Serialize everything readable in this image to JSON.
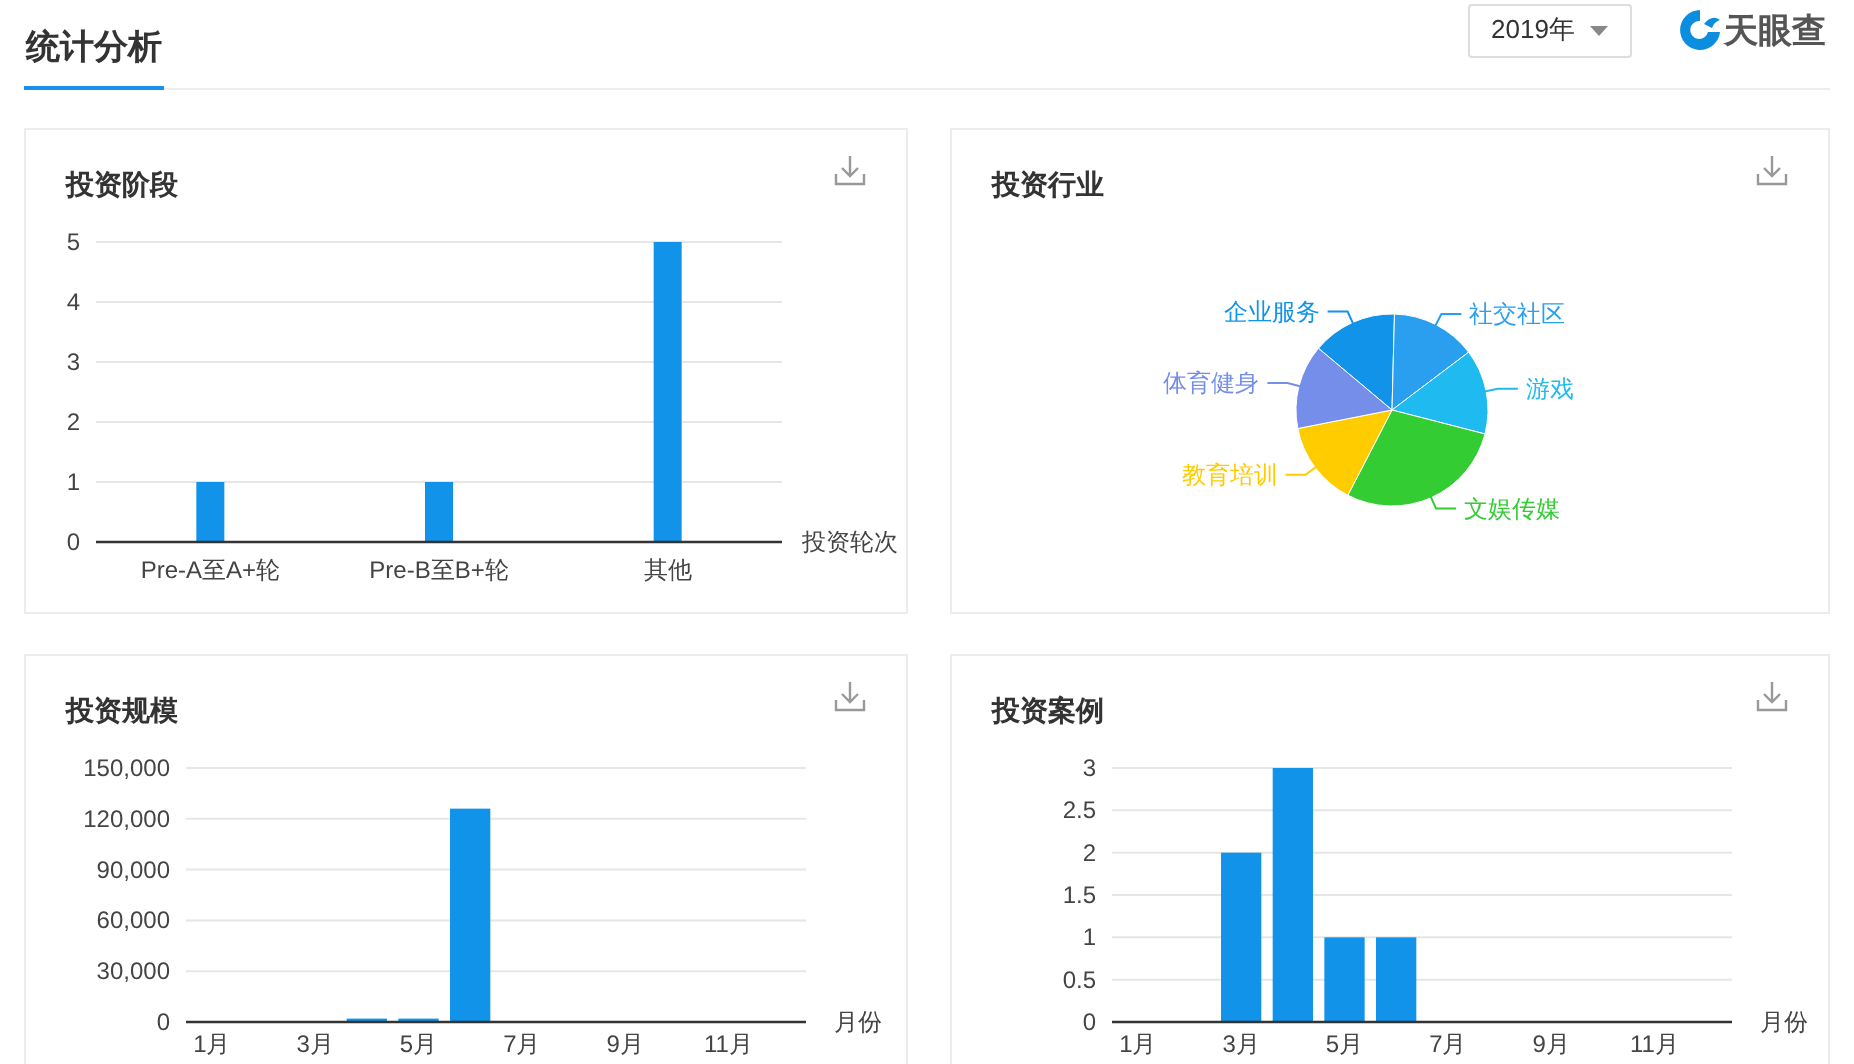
{
  "header": {
    "title": "统计分析",
    "year": "2019年",
    "logo": "天眼查"
  },
  "panels": [
    {
      "title": "投资阶段",
      "chart_data": {
        "type": "bar",
        "xlabel": "投资轮次",
        "grid": true,
        "categories": [
          "Pre-A至A+轮",
          "Pre-B至B+轮",
          "其他"
        ],
        "series": [
          {
            "color": "#1193ea",
            "values": [
              1,
              1,
              5
            ]
          }
        ],
        "ylim": [
          0,
          5
        ],
        "yticks": [
          0,
          1,
          2,
          3,
          4,
          5
        ]
      }
    },
    {
      "title": "投资行业",
      "chart_data": {
        "type": "pie",
        "categories": [
          "企业服务",
          "社交社区",
          "游戏",
          "文娱传媒",
          "教育培训",
          "体育健身"
        ],
        "colors": [
          "#1193ea",
          "#2a9ff0",
          "#1fbbf0",
          "#33cc33",
          "#ffcc00",
          "#748eea"
        ],
        "values": [
          14.3,
          14.3,
          14.3,
          28.6,
          14.3,
          14.2
        ]
      }
    },
    {
      "title": "投资规模",
      "chart_data": {
        "type": "bar",
        "xlabel": "月份",
        "grid": true,
        "x": [
          1,
          2,
          3,
          4,
          5,
          6,
          7,
          8,
          9,
          10,
          11,
          12
        ],
        "xlim": [
          0.5,
          12.5
        ],
        "xticks": [
          {
            "value": 1,
            "label": "1月"
          },
          {
            "value": 3,
            "label": "3月"
          },
          {
            "value": 5,
            "label": "5月"
          },
          {
            "value": 7,
            "label": "7月"
          },
          {
            "value": 9,
            "label": "9月"
          },
          {
            "value": 11,
            "label": "11月"
          }
        ],
        "series": [
          {
            "color": "#1193ea",
            "values": [
              0,
              0,
              0,
              2000,
              2000,
              126000,
              0,
              0,
              0,
              0,
              0,
              0
            ]
          }
        ],
        "ylim": [
          0,
          150000
        ],
        "yticks": [
          {
            "value": 0,
            "label": "0"
          },
          {
            "value": 30000,
            "label": "30,000"
          },
          {
            "value": 60000,
            "label": "60,000"
          },
          {
            "value": 90000,
            "label": "90,000"
          },
          {
            "value": 120000,
            "label": "120,000"
          },
          {
            "value": 150000,
            "label": "150,000"
          }
        ]
      }
    },
    {
      "title": "投资案例",
      "chart_data": {
        "type": "bar",
        "xlabel": "月份",
        "grid": true,
        "x": [
          1,
          2,
          3,
          4,
          5,
          6,
          7,
          8,
          9,
          10,
          11,
          12
        ],
        "xlim": [
          0.5,
          12.5
        ],
        "xticks": [
          {
            "value": 1,
            "label": "1月"
          },
          {
            "value": 3,
            "label": "3月"
          },
          {
            "value": 5,
            "label": "5月"
          },
          {
            "value": 7,
            "label": "7月"
          },
          {
            "value": 9,
            "label": "9月"
          },
          {
            "value": 11,
            "label": "11月"
          }
        ],
        "series": [
          {
            "color": "#1193ea",
            "values": [
              0,
              0,
              2,
              3,
              1,
              1,
              0,
              0,
              0,
              0,
              0,
              0
            ]
          }
        ],
        "ylim": [
          0,
          3
        ],
        "yticks": [
          0,
          0.5,
          1,
          1.5,
          2,
          2.5,
          3
        ]
      }
    }
  ]
}
